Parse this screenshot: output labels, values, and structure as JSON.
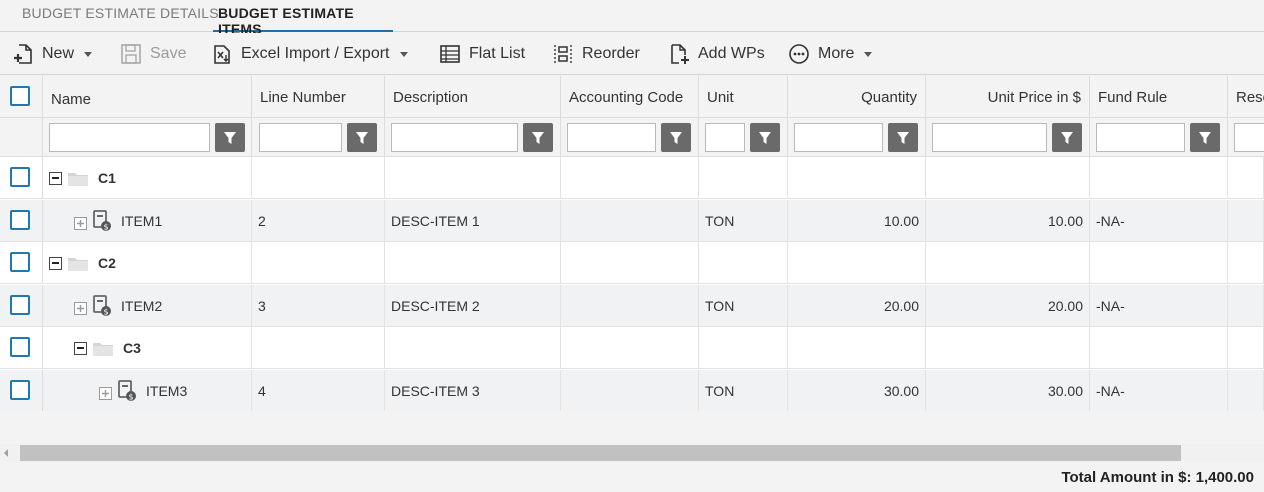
{
  "tabs": [
    {
      "label": "BUDGET ESTIMATE DETAILS",
      "active": false
    },
    {
      "label": "BUDGET ESTIMATE ITEMS",
      "active": true
    }
  ],
  "toolbar": {
    "new_label": "New",
    "save_label": "Save",
    "excel_label": "Excel Import / Export",
    "flatlist_label": "Flat List",
    "reorder_label": "Reorder",
    "addwps_label": "Add WPs",
    "more_label": "More"
  },
  "columns": [
    "Name",
    "Line Number",
    "Description",
    "Accounting Code",
    "Unit",
    "Quantity",
    "Unit Price in $",
    "Fund Rule",
    "Reso"
  ],
  "rows": [
    {
      "name": "C1",
      "type": "group",
      "level": 0,
      "line": "",
      "desc": "",
      "acct": "",
      "unit": "",
      "qty": "",
      "price": "",
      "fund": ""
    },
    {
      "name": "ITEM1",
      "type": "item",
      "level": 1,
      "line": "2",
      "desc": "DESC-ITEM 1",
      "acct": "",
      "unit": "TON",
      "qty": "10.00",
      "price": "10.00",
      "fund": "-NA-"
    },
    {
      "name": "C2",
      "type": "group",
      "level": 0,
      "line": "",
      "desc": "",
      "acct": "",
      "unit": "",
      "qty": "",
      "price": "",
      "fund": ""
    },
    {
      "name": "ITEM2",
      "type": "item",
      "level": 1,
      "line": "3",
      "desc": "DESC-ITEM 2",
      "acct": "",
      "unit": "TON",
      "qty": "20.00",
      "price": "20.00",
      "fund": "-NA-"
    },
    {
      "name": "C3",
      "type": "group",
      "level": 1,
      "line": "",
      "desc": "",
      "acct": "",
      "unit": "",
      "qty": "",
      "price": "",
      "fund": ""
    },
    {
      "name": "ITEM3",
      "type": "item",
      "level": 2,
      "line": "4",
      "desc": "DESC-ITEM 3",
      "acct": "",
      "unit": "TON",
      "qty": "30.00",
      "price": "30.00",
      "fund": "-NA-"
    }
  ],
  "footer": {
    "total": "Total Amount in $: 1,400.00"
  },
  "colors": {
    "accent": "#1e78b4",
    "filter_button": "#6a6a6a",
    "scroll_thumb": "#c1c1c1"
  }
}
